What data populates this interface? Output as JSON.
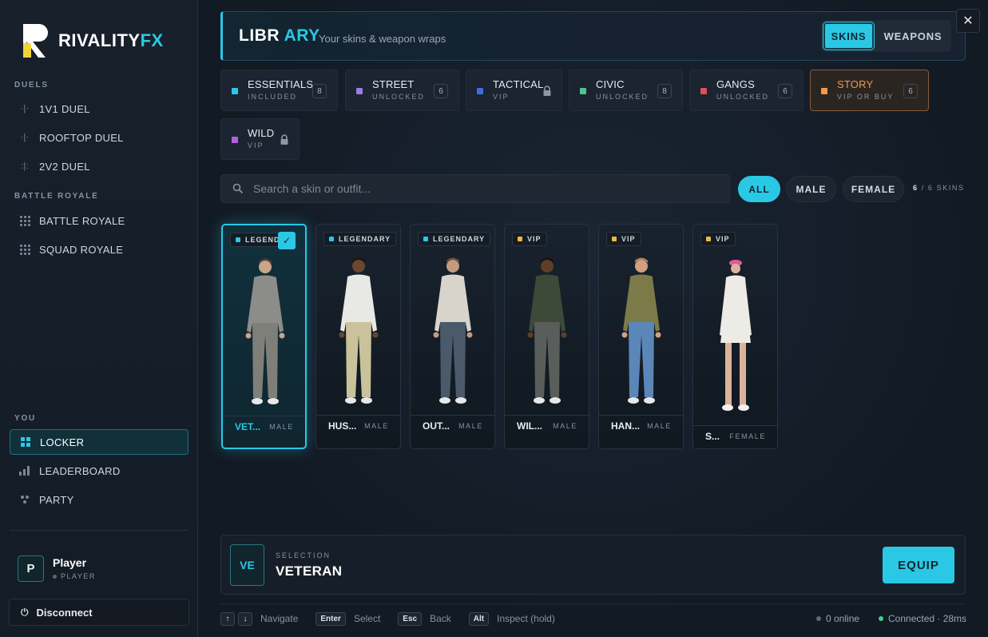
{
  "brand": {
    "name_main": "RIVALITY",
    "name_accent": "FX"
  },
  "sidebar": {
    "sections": {
      "duels": "DUELS",
      "battle_royale": "BATTLE ROYALE",
      "you": "YOU"
    },
    "duels": [
      {
        "label": "1V1 DUEL"
      },
      {
        "label": "ROOFTOP DUEL"
      },
      {
        "label": "2V2 DUEL"
      }
    ],
    "battle": [
      {
        "label": "BATTLE ROYALE"
      },
      {
        "label": "SQUAD ROYALE"
      }
    ],
    "you": [
      {
        "label": "LOCKER",
        "active": true
      },
      {
        "label": "LEADERBOARD"
      },
      {
        "label": "PARTY"
      }
    ],
    "player": {
      "initial": "P",
      "name": "Player",
      "role": "PLAYER"
    },
    "disconnect_label": "Disconnect"
  },
  "header": {
    "title_a": "LIBR",
    "title_b": "ARY",
    "subtitle": "Your skins & weapon wraps",
    "tabs": {
      "skins": "SKINS",
      "weapons": "WEAPONS"
    },
    "close": "✕"
  },
  "categories": [
    {
      "name": "ESSENTIALS",
      "sub": "INCLUDED",
      "count": "8",
      "color": "#2bc8e6"
    },
    {
      "name": "STREET",
      "sub": "UNLOCKED",
      "count": "6",
      "color": "#9b7be8"
    },
    {
      "name": "TACTICAL",
      "sub": "VIP",
      "color": "#3a6fe0",
      "locked": true
    },
    {
      "name": "CIVIC",
      "sub": "UNLOCKED",
      "count": "8",
      "color": "#4bc88a"
    },
    {
      "name": "GANGS",
      "sub": "UNLOCKED",
      "count": "6",
      "color": "#e05050"
    },
    {
      "name": "STORY",
      "sub": "VIP OR BUY",
      "count": "6",
      "color": "#f29a4a",
      "active": true
    },
    {
      "name": "WILD",
      "sub": "VIP",
      "color": "#b45ee0",
      "locked": true
    }
  ],
  "filters": {
    "search_placeholder": "Search a skin or outfit...",
    "all": "ALL",
    "male": "MALE",
    "female": "FEMALE",
    "count_shown": "6",
    "count_text": "/ 6 SKINS"
  },
  "skins": [
    {
      "tier": "LEGENDARY",
      "tier_short": "LEGEND",
      "tier_color": "#2bc8e6",
      "name": "VET...",
      "gender": "MALE",
      "selected": true,
      "shirt": "#8c8c88",
      "pants": "#7f7f7a",
      "skin": "#c9a58a",
      "hair": "#5a3e2b"
    },
    {
      "tier": "LEGENDARY",
      "tier_color": "#2bc8e6",
      "name": "HUS...",
      "gender": "MALE",
      "shirt": "#e8e8e4",
      "pants": "#c9c29a",
      "skin": "#6b4630",
      "hair": "#1e1410"
    },
    {
      "tier": "LEGENDARY",
      "tier_color": "#2bc8e6",
      "name": "OUT...",
      "gender": "MALE",
      "shirt": "#d8d4cc",
      "pants": "#4a5a6a",
      "skin": "#c39a80",
      "hair": "#6a5040"
    },
    {
      "tier": "VIP",
      "tier_color": "#f2b640",
      "name": "WIL...",
      "gender": "MALE",
      "shirt": "#3d4a38",
      "pants": "#5a5e5a",
      "skin": "#5e3e28",
      "hair": "#1a1210"
    },
    {
      "tier": "VIP",
      "tier_color": "#f2b640",
      "name": "HAN...",
      "gender": "MALE",
      "shirt": "#7d7a4a",
      "pants": "#5b86b8",
      "skin": "#d0a080",
      "hair": "#b08060"
    },
    {
      "tier": "VIP",
      "tier_color": "#f2b640",
      "name": "S...",
      "gender": "FEMALE",
      "shirt": "#ecebe6",
      "pants": "#ecebe6",
      "skin": "#d9b39a",
      "hair": "#e25a9a"
    }
  ],
  "selection": {
    "initials": "VE",
    "label": "SELECTION",
    "name": "VETERAN",
    "equip": "EQUIP"
  },
  "hints": {
    "up": "↑",
    "down": "↓",
    "navigate": "Navigate",
    "enter": "Enter",
    "select": "Select",
    "esc": "Esc",
    "back": "Back",
    "alt": "Alt",
    "inspect": "Inspect (hold)"
  },
  "status": {
    "online": "0 online",
    "connected": "Connected · 28ms",
    "online_color": "#5c6875",
    "connected_color": "#3ad28a"
  }
}
